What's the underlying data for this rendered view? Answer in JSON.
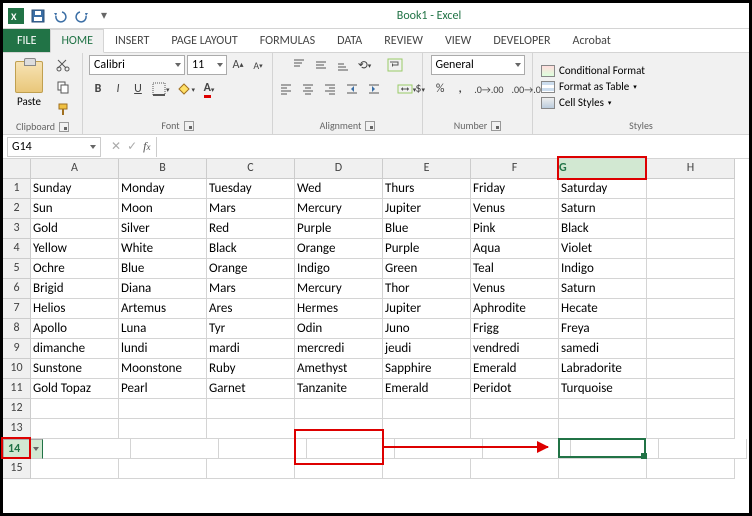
{
  "title": "Book1 - Excel",
  "tabs": {
    "file": "FILE",
    "home": "HOME",
    "insert": "INSERT",
    "pagelayout": "PAGE LAYOUT",
    "formulas": "FORMULAS",
    "data": "DATA",
    "review": "REVIEW",
    "view": "VIEW",
    "developer": "DEVELOPER",
    "acrobat": "Acrobat"
  },
  "ribbon": {
    "clipboard": {
      "paste": "Paste",
      "label": "Clipboard"
    },
    "font": {
      "name": "Calibri",
      "size": "11",
      "bold": "B",
      "italic": "I",
      "underline": "U",
      "label": "Font"
    },
    "alignment": {
      "label": "Alignment"
    },
    "number": {
      "format": "General",
      "label": "Number"
    },
    "styles": {
      "cond": "Conditional Format",
      "table": "Format as Table",
      "cell": "Cell Styles",
      "label": "Styles"
    }
  },
  "namebox": "G14",
  "columns": [
    "A",
    "B",
    "C",
    "D",
    "E",
    "F",
    "G",
    "H"
  ],
  "rows": [
    [
      "Sunday",
      "Monday",
      "Tuesday",
      "Wed",
      "Thurs",
      "Friday",
      "Saturday",
      ""
    ],
    [
      "Sun",
      "Moon",
      "Mars",
      "Mercury",
      "Jupiter",
      "Venus",
      "Saturn",
      ""
    ],
    [
      "Gold",
      "Silver",
      "Red",
      "Purple",
      "Blue",
      "Pink",
      "Black",
      ""
    ],
    [
      "Yellow",
      "White",
      "Black",
      "Orange",
      "Purple",
      "Aqua",
      "Violet",
      ""
    ],
    [
      "Ochre",
      "Blue",
      "Orange",
      "Indigo",
      "Green",
      "Teal",
      "Indigo",
      ""
    ],
    [
      "Brigid",
      "Diana",
      "Mars",
      "Mercury",
      "Thor",
      "Venus",
      "Saturn",
      ""
    ],
    [
      "Helios",
      "Artemus",
      "Ares",
      "Hermes",
      "Jupiter",
      "Aphrodite",
      "Hecate",
      ""
    ],
    [
      "Apollo",
      "Luna",
      "Tyr",
      "Odin",
      "Juno",
      "Frigg",
      "Freya",
      ""
    ],
    [
      "dimanche",
      "lundi",
      "mardi",
      "mercredi",
      "jeudi",
      "vendredi",
      "samedi",
      ""
    ],
    [
      "Sunstone",
      "Moonstone",
      "Ruby",
      "Amethyst",
      "Sapphire",
      "Emerald",
      "Labradorite",
      ""
    ],
    [
      "Gold Topaz",
      "Pearl",
      "Garnet",
      "Tanzanite",
      "Emerald",
      "Peridot",
      "Turquoise",
      ""
    ],
    [
      "",
      "",
      "",
      "",
      "",
      "",
      "",
      ""
    ],
    [
      "",
      "",
      "",
      "",
      "",
      "",
      "",
      ""
    ],
    [
      "",
      "",
      "",
      "",
      "",
      "",
      "",
      ""
    ],
    [
      "",
      "",
      "",
      "",
      "",
      "",
      "",
      ""
    ]
  ],
  "active": {
    "col": "G",
    "row": 14
  }
}
